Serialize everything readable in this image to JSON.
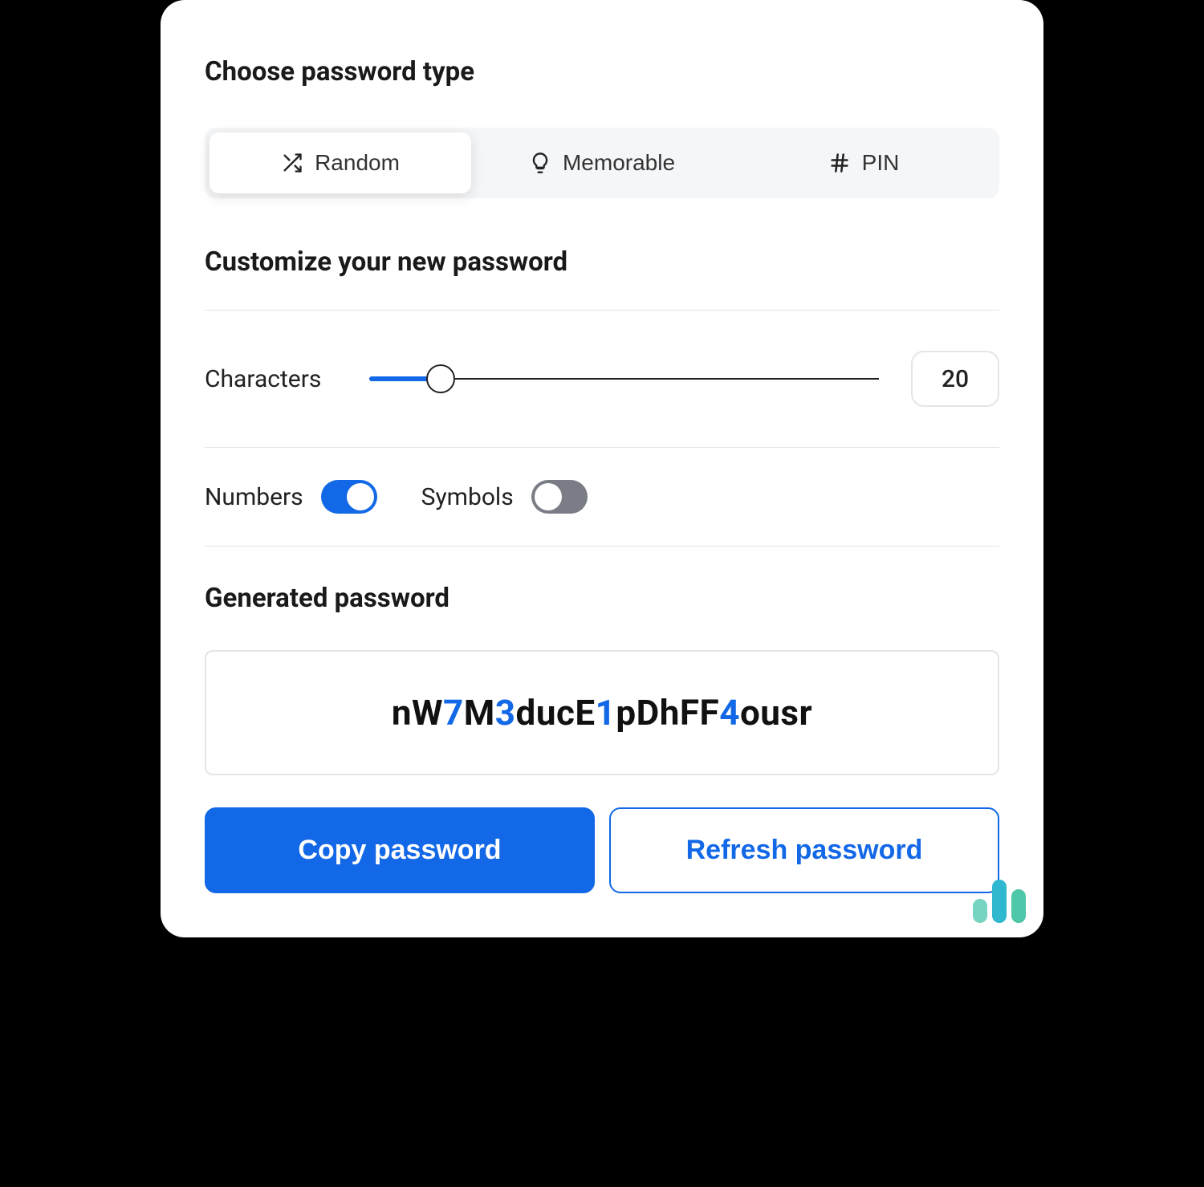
{
  "headings": {
    "choose_type": "Choose password type",
    "customize": "Customize your new password",
    "generated": "Generated password"
  },
  "tabs": {
    "random": "Random",
    "memorable": "Memorable",
    "pin": "PIN",
    "active": "random"
  },
  "options": {
    "characters_label": "Characters",
    "characters_value": "20",
    "numbers_label": "Numbers",
    "numbers_on": true,
    "symbols_label": "Symbols",
    "symbols_on": false
  },
  "password": {
    "segments": [
      {
        "t": "nW",
        "d": false
      },
      {
        "t": "7",
        "d": true
      },
      {
        "t": "M",
        "d": false
      },
      {
        "t": "3",
        "d": true
      },
      {
        "t": "ducE",
        "d": false
      },
      {
        "t": "1",
        "d": true
      },
      {
        "t": "pDhFF",
        "d": false
      },
      {
        "t": "4",
        "d": true
      },
      {
        "t": "ousr",
        "d": false
      }
    ]
  },
  "actions": {
    "copy": "Copy password",
    "refresh": "Refresh password"
  }
}
